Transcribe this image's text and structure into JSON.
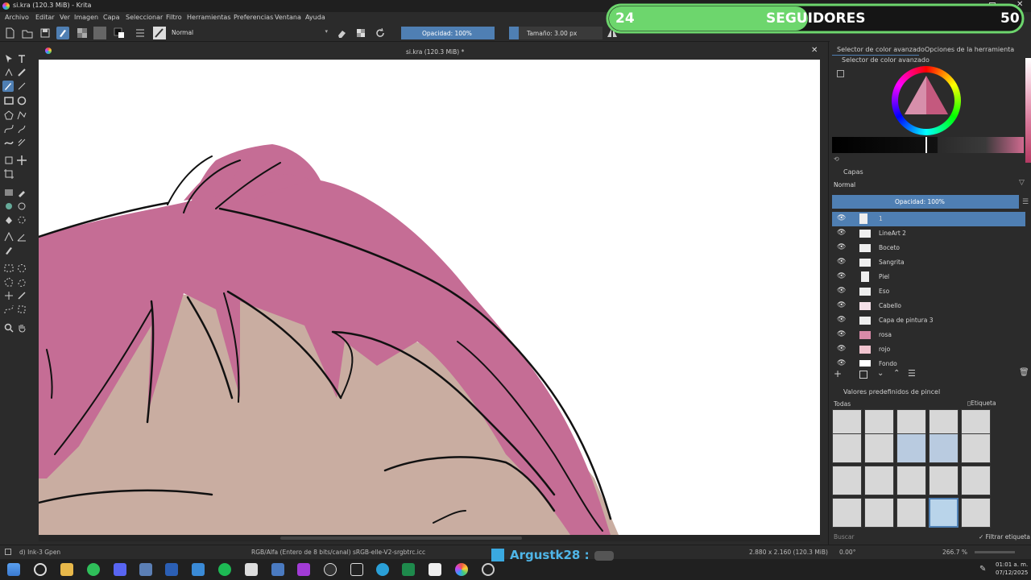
{
  "titlebar": {
    "title": "si.kra (120.3 MiB) - Krita"
  },
  "menu": [
    "Archivo",
    "Editar",
    "Ver",
    "Imagen",
    "Capa",
    "Seleccionar",
    "Filtro",
    "Herramientas",
    "Preferencias",
    "Ventana",
    "Ayuda"
  ],
  "toolbar": {
    "blend_mode": "Normal",
    "opacity": "Opacidad: 100%",
    "size": "Tamaño: 3.00 px"
  },
  "document": {
    "tab_title": "si.kra (120.3 MiB) *"
  },
  "dock": {
    "tabs": [
      "Selector de color avanzado",
      "Opciones de la herramienta"
    ],
    "color_selector_title": "Selector de color avanzado",
    "layers_title": "Capas",
    "layers_blend": "Normal",
    "layers_opacity": "Opacidad: 100%",
    "layers": [
      {
        "name": "1",
        "selected": true
      },
      {
        "name": "LineArt 2"
      },
      {
        "name": "Boceto"
      },
      {
        "name": "Sangrita"
      },
      {
        "name": "Piel"
      },
      {
        "name": "Eso"
      },
      {
        "name": "Cabello"
      },
      {
        "name": "Capa de pintura 3"
      },
      {
        "name": "rosa"
      },
      {
        "name": "rojo"
      },
      {
        "name": "Fondo"
      }
    ],
    "brush_presets_title": "Valores predefinidos de pincel",
    "brush_filter": "Todas",
    "brush_tag_label": "Etiqueta",
    "search_placeholder": "Buscar",
    "filter_tag_label": "Filtrar etiqueta"
  },
  "status": {
    "brush": "d) Ink-3 Gpen",
    "color_space": "RGB/Alfa (Entero de 8 bits/canal)  sRGB-elle-V2-srgbtrc.icc",
    "image_size": "2.880 x 2.160 (120.3 MiB)",
    "rotation": "0.00°",
    "zoom": "266.7 %"
  },
  "clock": {
    "time": "01:01 a. m.",
    "date": "07/12/2025"
  },
  "overlay": {
    "followers_current": "24",
    "followers_label": "SEGUIDORES",
    "followers_goal": "50",
    "username": "Argustk28 :"
  },
  "colors": {
    "hair_pink": "#c56d95",
    "skin": "#c9ada1",
    "accent_blue": "#4f7fb3",
    "overlay_green": "#6dd66d"
  }
}
